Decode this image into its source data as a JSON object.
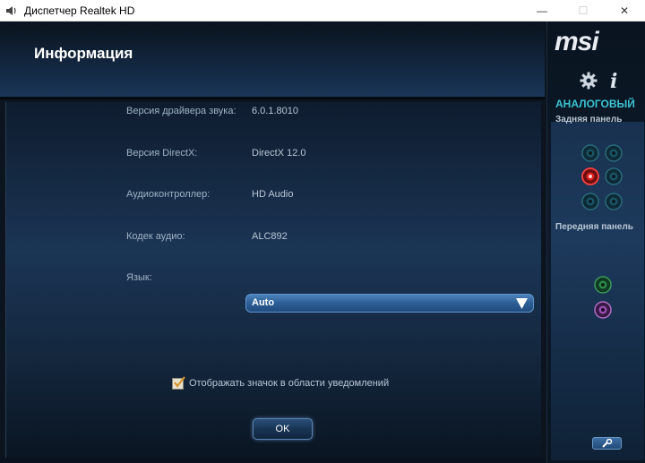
{
  "window": {
    "title": "Диспетчер Realtek HD",
    "min_glyph": "—",
    "max_glyph": "☐",
    "close_glyph": "✕"
  },
  "header": {
    "title": "Информация"
  },
  "info": {
    "rows": [
      {
        "label": "Версия драйвера звука:",
        "value": "6.0.1.8010"
      },
      {
        "label": "Версия DirectX:",
        "value": "DirectX 12.0"
      },
      {
        "label": "Аудиоконтроллер:",
        "value": "HD Audio"
      },
      {
        "label": "Кодек аудио:",
        "value": "ALC892"
      }
    ],
    "language_label": "Язык:",
    "language_value": "Auto",
    "notify_label": "Отображать значок в области уведомлений",
    "notify_checked": true,
    "ok_label": "OK"
  },
  "side": {
    "logo": "msi",
    "analog_label": "АНАЛОГОВЫЙ",
    "rear_panel_label": "Задняя панель",
    "front_panel_label": "Передняя панель",
    "info_glyph": "i",
    "icons": [
      "gear-icon",
      "info-icon",
      "wrench-icon"
    ],
    "rear_jacks": [
      {
        "color": "#1a5566",
        "state": "inactive"
      },
      {
        "color": "#1a5566",
        "state": "inactive"
      },
      {
        "color": "#e02020",
        "state": "active"
      },
      {
        "color": "#1a5566",
        "state": "inactive"
      },
      {
        "color": "#1a5566",
        "state": "inactive"
      },
      {
        "color": "#1a5566",
        "state": "inactive"
      }
    ],
    "front_jacks": [
      {
        "color": "#2f8a4a",
        "state": "inactive"
      },
      {
        "color": "#9a4fb0",
        "state": "inactive"
      }
    ]
  },
  "colors": {
    "accent": "#3cc3d3",
    "select_blue": "#2c5e96",
    "background": "#0c1420"
  }
}
